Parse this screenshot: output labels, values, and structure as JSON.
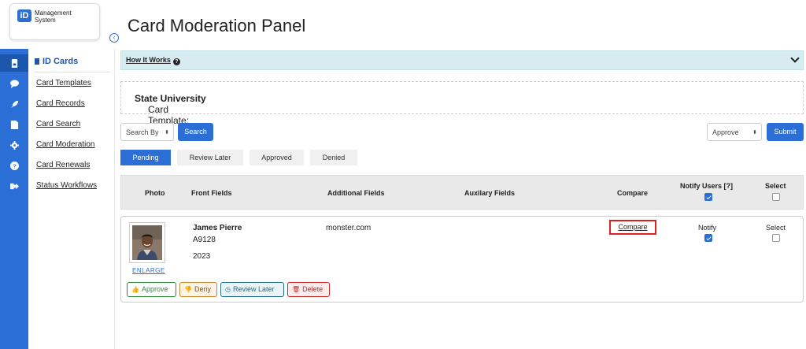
{
  "brand": {
    "logo_mark": "iD",
    "line1": "Management",
    "line2": "System"
  },
  "rail": {
    "icons": [
      "id-card-icon",
      "chat-icon",
      "rocket-icon",
      "document-icon",
      "gear-icon",
      "help-icon",
      "logout-icon"
    ]
  },
  "sidebar": {
    "heading": "ID Cards",
    "items": [
      {
        "label": "Card Templates"
      },
      {
        "label": "Card Records"
      },
      {
        "label": "Card Search"
      },
      {
        "label": "Card Moderation"
      },
      {
        "label": "Card Renewals"
      },
      {
        "label": "Status Workflows"
      }
    ]
  },
  "page": {
    "title": "Card Moderation Panel"
  },
  "how_it_works": {
    "label": "How It Works",
    "q": "?"
  },
  "template": {
    "prefix": "Card Template: ",
    "name": "State University"
  },
  "search": {
    "select_value": "Search By",
    "button": "Search"
  },
  "action": {
    "select_value": "Approve",
    "submit": "Submit"
  },
  "tabs": [
    {
      "label": "Pending",
      "active": true
    },
    {
      "label": "Review Later"
    },
    {
      "label": "Approved"
    },
    {
      "label": "Denied"
    }
  ],
  "table": {
    "headers": {
      "photo": "Photo",
      "front": "Front Fields",
      "additional": "Additional Fields",
      "auxiliary": "Auxilary Fields",
      "compare": "Compare",
      "notify": "Notify Users [?]",
      "select": "Select"
    },
    "notify_all_checked": true,
    "select_all_checked": false,
    "rows": [
      {
        "name": "James Pierre",
        "id": "A9128",
        "year": "2023",
        "additional": "monster.com",
        "compare": "Compare",
        "notify_label": "Notify",
        "notify_checked": true,
        "select_label": "Select",
        "select_checked": false,
        "enlarge": "ENLARGE",
        "actions": {
          "approve": "Approve",
          "deny": "Deny",
          "review": "Review Later",
          "delete": "Delete"
        }
      }
    ]
  },
  "colors": {
    "primary": "#2b6fd6",
    "info_bg": "#d6ecf1",
    "approve": "#2e8b3a",
    "deny": "#c98a2b",
    "review": "#1f6e86",
    "delete": "#c62828"
  }
}
